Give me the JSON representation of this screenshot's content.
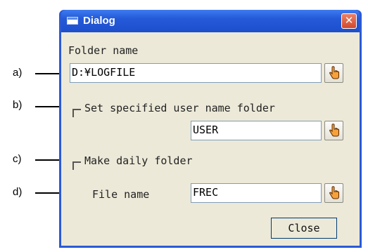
{
  "annotations": {
    "a": "a)",
    "b": "b)",
    "c": "c)",
    "d": "d)"
  },
  "window": {
    "title": "Dialog",
    "close_glyph": "✕"
  },
  "folder": {
    "label": "Folder name",
    "value": "D:¥LOGFILE"
  },
  "user_folder": {
    "label": "Set specified user name folder",
    "checked": false,
    "value": "USER"
  },
  "daily_folder": {
    "label": "Make daily folder",
    "checked": false
  },
  "file": {
    "label": "File name",
    "value": "FREC"
  },
  "buttons": {
    "close": "Close"
  },
  "icons": {
    "browse": "hand-pointer-icon",
    "window": "window-icon",
    "close": "close-icon"
  }
}
